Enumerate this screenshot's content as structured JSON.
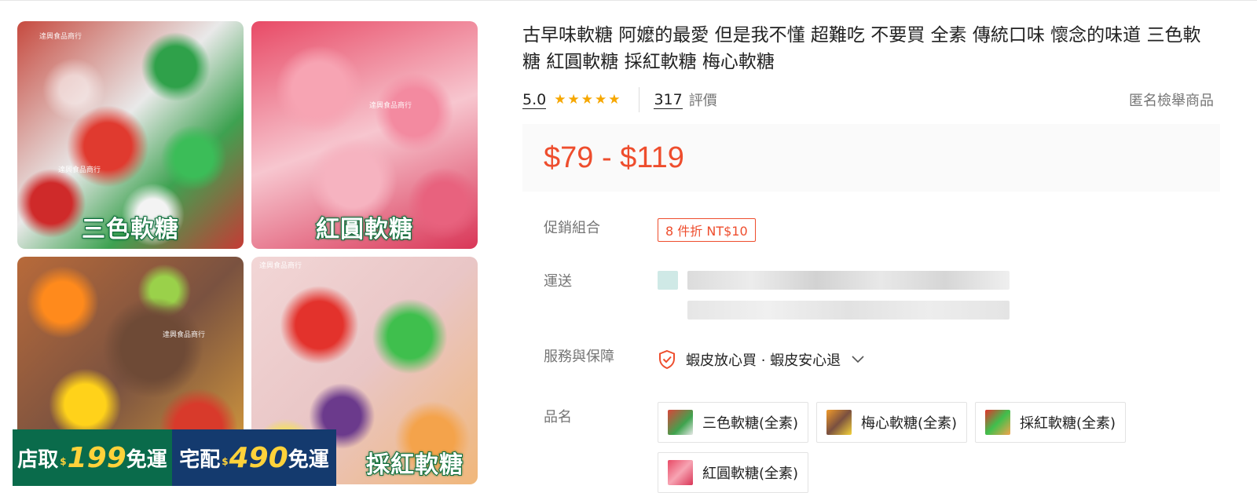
{
  "gallery": {
    "tiles": [
      {
        "caption": "三色軟糖",
        "watermark": "達興食品商行"
      },
      {
        "caption": "紅圓軟糖",
        "watermark": "達興食品商行"
      },
      {
        "caption": "",
        "watermark": "達興食品商行"
      },
      {
        "caption": "採紅軟糖",
        "watermark": "達興食品商行"
      }
    ],
    "promo_banner": {
      "store_pickup": {
        "label": "店取",
        "currency": "$",
        "amount": "199",
        "suffix": "免運"
      },
      "home_delivery": {
        "label": "宅配",
        "currency": "$",
        "amount": "490",
        "suffix": "免運"
      }
    }
  },
  "product": {
    "title": "古早味軟糖 阿嬤的最愛 但是我不懂 超難吃 不要買 全素 傳統口味 懷念的味道 三色軟糖 紅圓軟糖 採紅軟糖 梅心軟糖",
    "rating": {
      "score": "5.0",
      "stars": 5
    },
    "reviews": {
      "count": "317",
      "label": "評價"
    },
    "report_label": "匿名檢舉商品",
    "price": "$79 - $119",
    "promo": {
      "label": "促銷組合",
      "tag": "8 件折 NT$10"
    },
    "shipping": {
      "label": "運送"
    },
    "service": {
      "label": "服務與保障",
      "text": "蝦皮放心買 · 蝦皮安心退"
    },
    "variants": {
      "label": "品名",
      "options": [
        "三色軟糖(全素)",
        "梅心軟糖(全素)",
        "採紅軟糖(全素)",
        "紅圓軟糖(全素)"
      ]
    }
  },
  "colors": {
    "accent": "#ee4d2d",
    "star": "#f6a700",
    "muted": "#757575"
  }
}
